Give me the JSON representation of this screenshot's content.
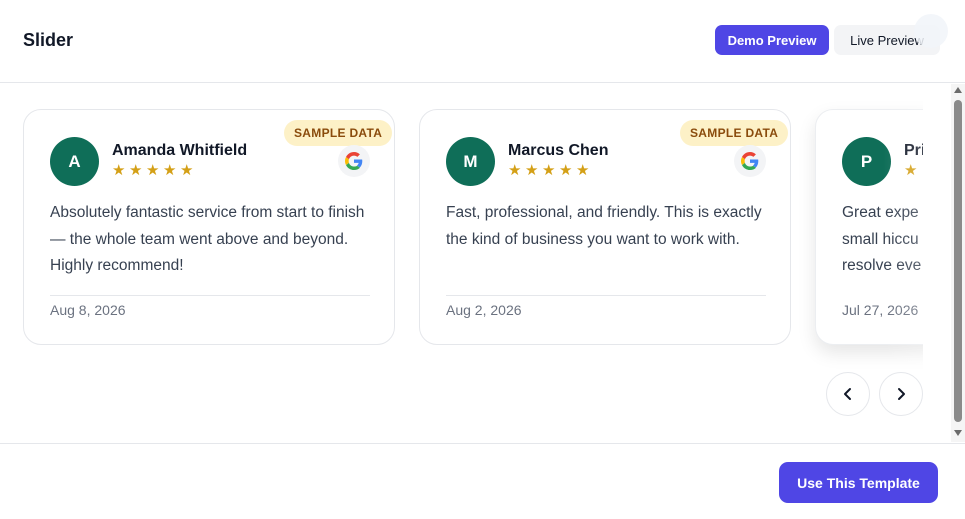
{
  "header": {
    "title": "Slider",
    "demo_button": "Demo Preview",
    "live_button": "Live Preview"
  },
  "reviews": [
    {
      "initial": "A",
      "name": "Amanda Whitfield",
      "rating": 5,
      "badge": "SAMPLE DATA",
      "source_icon": "google-icon",
      "text": "Absolutely fantastic service from start to finish — the whole team went above and beyond. Highly recommend!",
      "date": "Aug 8, 2026"
    },
    {
      "initial": "M",
      "name": "Marcus Chen",
      "rating": 5,
      "badge": "SAMPLE DATA",
      "source_icon": "google-icon",
      "text": "Fast, professional, and friendly. This is exactly the kind of business you want to work with.",
      "date": "Aug 2, 2026"
    },
    {
      "initial": "P",
      "name": "Pri",
      "rating": 1,
      "text": "Great expe small hiccu resolve eve",
      "date": "Jul 27, 2026"
    }
  ],
  "carousel": {
    "prev_icon": "chevron-left-icon",
    "next_icon": "chevron-right-icon"
  },
  "footer": {
    "use_template_button": "Use This Template"
  },
  "colors": {
    "accent": "#4f46e5",
    "avatar": "#0f6e58",
    "star": "#d4a017",
    "badge_bg": "#fdf1c7",
    "badge_text": "#8a4b0c"
  }
}
